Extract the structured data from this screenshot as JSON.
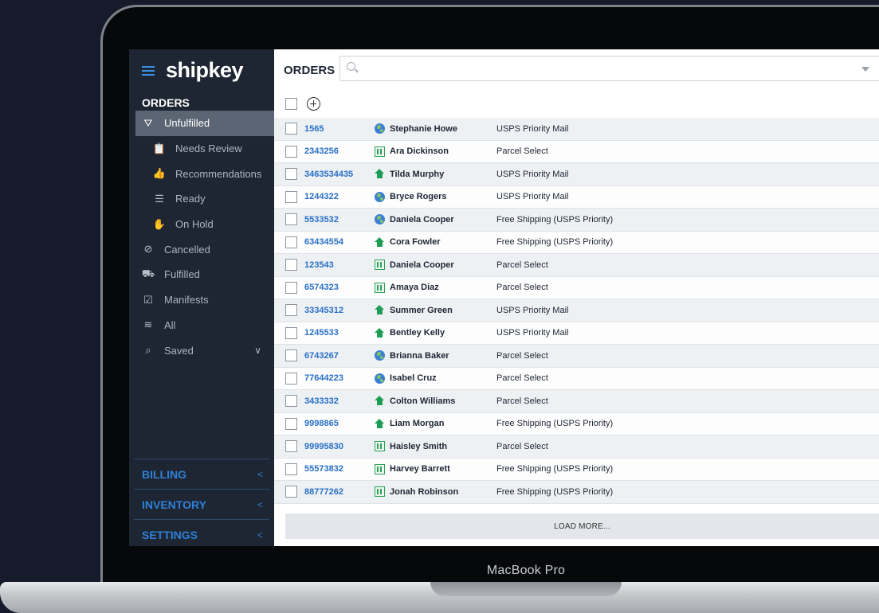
{
  "device": {
    "label": "MacBook Pro"
  },
  "app": {
    "brand": "shipkey"
  },
  "sidebar": {
    "heading": "ORDERS",
    "items": [
      {
        "label": "Unfulfilled",
        "icon": "parachute-icon",
        "glyph": "⛛",
        "active": true,
        "sub": false
      },
      {
        "label": "Needs Review",
        "icon": "clipboard-icon",
        "glyph": "📋",
        "active": false,
        "sub": true
      },
      {
        "label": "Recommendations",
        "icon": "thumbs-up-icon",
        "glyph": "👍",
        "active": false,
        "sub": true
      },
      {
        "label": "Ready",
        "icon": "stack-icon",
        "glyph": "☰",
        "active": false,
        "sub": true
      },
      {
        "label": "On Hold",
        "icon": "hand-icon",
        "glyph": "✋",
        "active": false,
        "sub": true
      },
      {
        "label": "Cancelled",
        "icon": "ban-icon",
        "glyph": "⊘",
        "active": false,
        "sub": false
      },
      {
        "label": "Fulfilled",
        "icon": "truck-icon",
        "glyph": "⛟",
        "active": false,
        "sub": false
      },
      {
        "label": "Manifests",
        "icon": "checklist-icon",
        "glyph": "☑",
        "active": false,
        "sub": false
      },
      {
        "label": "All",
        "icon": "layers-icon",
        "glyph": "≋",
        "active": false,
        "sub": false
      },
      {
        "label": "Saved",
        "icon": "saved-search-icon",
        "glyph": "⌕",
        "active": false,
        "sub": false,
        "chevron": "∨"
      }
    ],
    "sections": [
      {
        "label": "BILLING",
        "chevron": "<"
      },
      {
        "label": "INVENTORY",
        "chevron": "<"
      },
      {
        "label": "SETTINGS",
        "chevron": "<"
      }
    ]
  },
  "main": {
    "title": "ORDERS",
    "search": {
      "value": "",
      "placeholder": ""
    },
    "orders": [
      {
        "id": "1565",
        "customer": "Stephanie Howe",
        "icon": "globe",
        "shipping": "USPS Priority Mail"
      },
      {
        "id": "2343256",
        "customer": "Ara Dickinson",
        "icon": "building",
        "shipping": "Parcel Select"
      },
      {
        "id": "3463534435",
        "customer": "Tilda Murphy",
        "icon": "house",
        "shipping": "USPS Priority Mail"
      },
      {
        "id": "1244322",
        "customer": "Bryce Rogers",
        "icon": "globe",
        "shipping": "USPS Priority Mail"
      },
      {
        "id": "5533532",
        "customer": "Daniela Cooper",
        "icon": "globe",
        "shipping": "Free Shipping (USPS Priority)"
      },
      {
        "id": "63434554",
        "customer": "Cora Fowler",
        "icon": "house",
        "shipping": "Free Shipping (USPS Priority)"
      },
      {
        "id": "123543",
        "customer": "Daniela Cooper",
        "icon": "building",
        "shipping": "Parcel Select"
      },
      {
        "id": "6574323",
        "customer": "Amaya Diaz",
        "icon": "building",
        "shipping": "Parcel Select"
      },
      {
        "id": "33345312",
        "customer": "Summer Green",
        "icon": "house",
        "shipping": "USPS Priority Mail"
      },
      {
        "id": "1245533",
        "customer": "Bentley Kelly",
        "icon": "house",
        "shipping": "USPS Priority Mail"
      },
      {
        "id": "6743267",
        "customer": "Brianna Baker",
        "icon": "globe",
        "shipping": "Parcel Select"
      },
      {
        "id": "77644223",
        "customer": "Isabel Cruz",
        "icon": "globe",
        "shipping": "Parcel Select"
      },
      {
        "id": "3433332",
        "customer": "Colton Williams",
        "icon": "house",
        "shipping": "Parcel Select"
      },
      {
        "id": "9998865",
        "customer": "Liam Morgan",
        "icon": "house",
        "shipping": "Free Shipping (USPS Priority)"
      },
      {
        "id": "99995830",
        "customer": "Haisley Smith",
        "icon": "building",
        "shipping": "Parcel Select"
      },
      {
        "id": "55573832",
        "customer": "Harvey Barrett",
        "icon": "building",
        "shipping": "Free Shipping (USPS Priority)"
      },
      {
        "id": "88777262",
        "customer": "Jonah Robinson",
        "icon": "building",
        "shipping": "Free Shipping (USPS Priority)"
      }
    ],
    "load_more_label": "LOAD MORE..."
  },
  "colors": {
    "sidebar_bg": "#1e2634",
    "accent": "#2f7fd6",
    "order_link": "#2a70c6",
    "active_item": "#5c6573"
  }
}
